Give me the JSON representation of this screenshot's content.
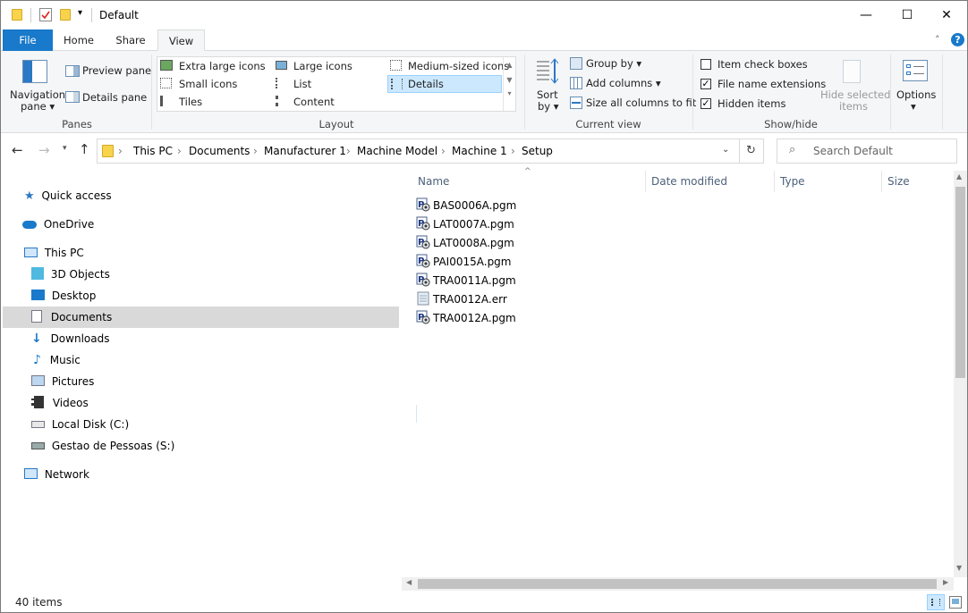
{
  "window": {
    "title": "Default",
    "minimize": "—",
    "maximize": "☐",
    "close": "✕"
  },
  "tabs": [
    "File",
    "Home",
    "Share",
    "View"
  ],
  "ribbon": {
    "panes": {
      "navigation_pane": "Navigation",
      "navigation_pane_2": "pane ▾",
      "preview_pane": "Preview pane",
      "details_pane": "Details pane",
      "title": "Panes"
    },
    "layout": {
      "title": "Layout",
      "items": [
        "Extra large icons",
        "Large icons",
        "Medium-sized icons",
        "Small icons",
        "List",
        "Details",
        "Tiles",
        "Content"
      ]
    },
    "current_view": {
      "title": "Current view",
      "sort_by": "Sort",
      "sort_by_2": "by ▾",
      "group_by": "Group by ▾",
      "add_columns": "Add columns ▾",
      "size_all_columns": "Size all columns to fit"
    },
    "show_hide": {
      "title": "Show/hide",
      "item_check_boxes": "Item check boxes",
      "file_name_extensions": "File name extensions",
      "hidden_items": "Hidden items",
      "hide_selected": "Hide selected",
      "hide_selected_2": "items"
    },
    "options": {
      "label": "Options",
      "arrow": "▾"
    }
  },
  "address": {
    "crumbs": [
      "This PC",
      "Documents",
      "Manufacturer 1",
      "Machine Model",
      "Machine 1",
      "Setup"
    ],
    "separator": "›",
    "search_placeholder": "Search Default"
  },
  "nav_pane": {
    "quick_access": "Quick access",
    "onedrive": "OneDrive",
    "this_pc": "This PC",
    "objects_3d": "3D Objects",
    "desktop": "Desktop",
    "documents": "Documents",
    "downloads": "Downloads",
    "music": "Music",
    "pictures": "Pictures",
    "videos": "Videos",
    "local_disk": "Local Disk (C:)",
    "gestao": "Gestao de Pessoas (S:)",
    "network": "Network"
  },
  "columns": [
    "Name",
    "Date modified",
    "Type",
    "Size"
  ],
  "files": [
    {
      "name": "BAS0006A.pgm",
      "kind": "pgm"
    },
    {
      "name": "LAT0007A.pgm",
      "kind": "pgm"
    },
    {
      "name": "LAT0008A.pgm",
      "kind": "pgm"
    },
    {
      "name": "PAI0015A.pgm",
      "kind": "pgm"
    },
    {
      "name": "TRA0011A.pgm",
      "kind": "pgm"
    },
    {
      "name": "TRA0012A.err",
      "kind": "err"
    },
    {
      "name": "TRA0012A.pgm",
      "kind": "pgm"
    }
  ],
  "status": {
    "item_count": "40 items"
  },
  "colors": {
    "file_tab": "#1979ca",
    "selection": "#d9d9d9",
    "column_header": "#4c607a"
  }
}
